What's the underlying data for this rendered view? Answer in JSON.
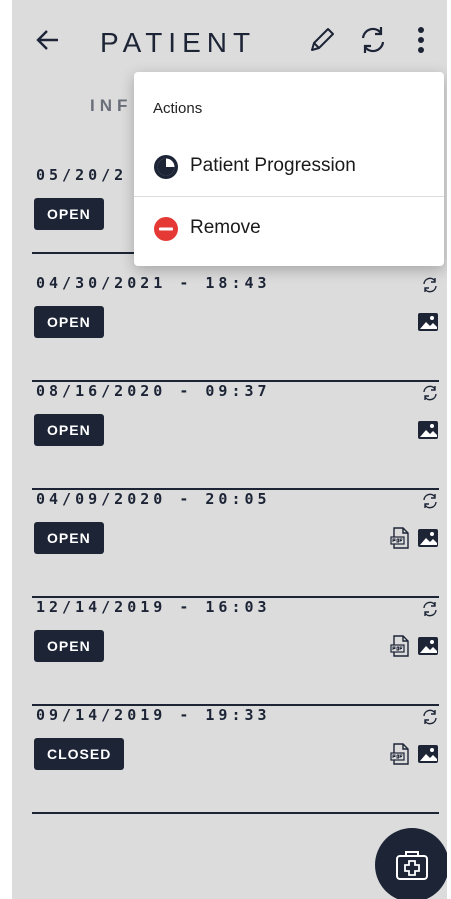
{
  "header": {
    "title": "PATIENT",
    "back_icon": "arrow-left-icon",
    "edit_icon": "pencil-icon",
    "sync_icon": "sync-icon",
    "more_icon": "more-vertical-icon"
  },
  "tab": {
    "label_partial": "INF"
  },
  "records": [
    {
      "datetime": "05/20/2",
      "status": "OPEN",
      "has_pdf": false,
      "has_image": false
    },
    {
      "datetime": "04/30/2021 - 18:43",
      "status": "OPEN",
      "has_pdf": false,
      "has_image": true
    },
    {
      "datetime": "08/16/2020 - 09:37",
      "status": "OPEN",
      "has_pdf": false,
      "has_image": true
    },
    {
      "datetime": "04/09/2020 - 20:05",
      "status": "OPEN",
      "has_pdf": true,
      "has_image": true
    },
    {
      "datetime": "12/14/2019 - 16:03",
      "status": "OPEN",
      "has_pdf": true,
      "has_image": true
    },
    {
      "datetime": "09/14/2019 - 19:33",
      "status": "CLOSED",
      "has_pdf": true,
      "has_image": true
    }
  ],
  "menu": {
    "header": "Actions",
    "items": [
      {
        "label": "Patient Progression",
        "icon": "progression-icon"
      },
      {
        "label": "Remove",
        "icon": "remove-icon"
      }
    ]
  },
  "fab": {
    "icon": "medical-kit-icon"
  },
  "colors": {
    "primary": "#1c2436",
    "overlay_bg": "#dcdcdc",
    "remove_red": "#e53935"
  }
}
